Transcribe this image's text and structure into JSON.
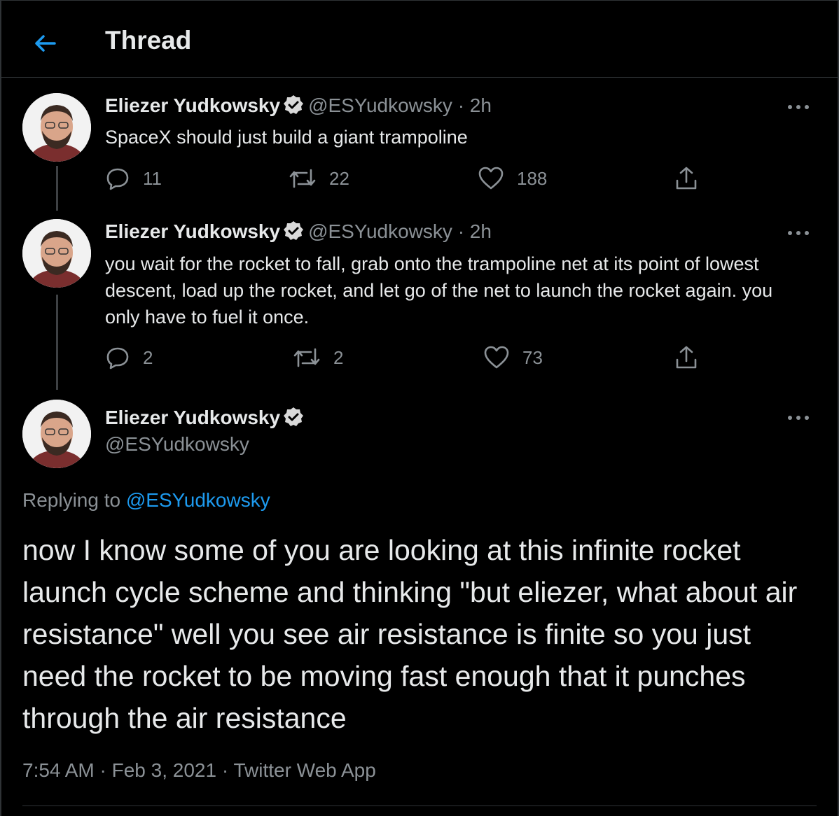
{
  "header": {
    "title": "Thread"
  },
  "author": {
    "name": "Eliezer Yudkowsky",
    "handle": "@ESYudkowsky"
  },
  "tweets": [
    {
      "time": "2h",
      "text": "SpaceX should just build a giant trampoline",
      "replies": "11",
      "retweets": "22",
      "likes": "188"
    },
    {
      "time": "2h",
      "text": "you wait for the rocket to fall, grab onto the trampoline net at its point of lowest descent, load up the rocket, and let go of the net to launch the rocket again.  you only have to fuel it once.",
      "replies": "2",
      "retweets": "2",
      "likes": "73"
    }
  ],
  "main": {
    "replying_prefix": "Replying to ",
    "replying_handle": "@ESYudkowsky",
    "text": "now I know some of you are looking at this infinite rocket launch cycle scheme and thinking \"but eliezer, what about air resistance\" well you see air resistance is finite so you just need the rocket to be moving fast enough that it punches through the air resistance",
    "timestamp": "7:54 AM · Feb 3, 2021 · Twitter Web App"
  },
  "separator": "·",
  "colors": {
    "accent": "#1d9bf0",
    "background": "#000000",
    "muted": "#8b9196"
  }
}
